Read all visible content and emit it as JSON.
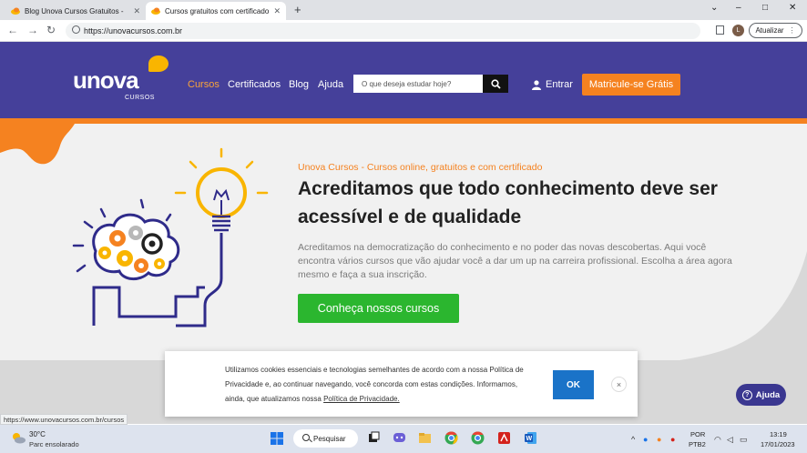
{
  "browser": {
    "tabs": [
      {
        "title": "Blog Unova Cursos Gratuitos -",
        "active": false
      },
      {
        "title": "Cursos gratuitos com certificado",
        "active": true
      }
    ],
    "new_tab": "+",
    "url": "https://unovacursos.com.br",
    "profile_initial": "L",
    "update_label": "Atualizar",
    "window_controls": {
      "minimize": "–",
      "maximize": "□",
      "close": "✕",
      "tabsearch": "⌄"
    }
  },
  "site": {
    "logo_word": "unova",
    "logo_sub": "CURSOS",
    "nav": [
      "Cursos",
      "Certificados",
      "Blog",
      "Ajuda"
    ],
    "search_placeholder": "O que deseja estudar hoje?",
    "login": "Entrar",
    "enroll": "Matricule-se Grátis",
    "colors": {
      "header": "#45409a",
      "accent": "#f58220",
      "cta": "#2bb62f"
    }
  },
  "hero": {
    "tagline": "Unova Cursos - Cursos online, gratuitos e com certificado",
    "headline": "Acreditamos que todo conhecimento deve ser acessível e de qualidade",
    "description": "Acreditamos na democratização do conhecimento e no poder das novas descobertas. Aqui você encontra vários cursos que vão ajudar você a dar um up na carreira profissional. Escolha a área agora mesmo e faça a sua inscrição.",
    "cta": "Conheça nossos cursos"
  },
  "cookie": {
    "text": "Utilizamos cookies essenciais e tecnologias semelhantes de acordo com a nossa Política de Privacidade e, ao continuar navegando, você concorda com estas condições. Informamos, ainda, que atualizamos nossa",
    "link": "Política de Privacidade.",
    "ok": "OK",
    "close": "×"
  },
  "help": {
    "label": "Ajuda",
    "q": "?"
  },
  "status_url": "https://www.unovacursos.com.br/cursos",
  "taskbar": {
    "weather_temp": "30°C",
    "weather_cond": "Parc ensolarado",
    "search": "Pesquisar",
    "lang": "POR",
    "layout": "PTB2",
    "time": "13:19",
    "date": "17/01/2023",
    "tray_up": "^"
  }
}
